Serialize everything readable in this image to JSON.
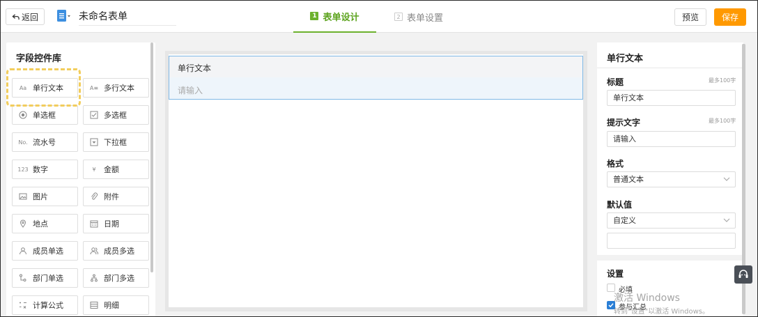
{
  "header": {
    "back_label": "返回",
    "form_name": "未命名表单",
    "steps": [
      {
        "num": "1",
        "label": "表单设计"
      },
      {
        "num": "2",
        "label": "表单设置"
      }
    ],
    "preview_label": "预览",
    "save_label": "保存",
    "accent_color": "#6cb12d",
    "save_color": "#ff9900"
  },
  "library": {
    "title": "字段控件库",
    "widgets": [
      {
        "label": "单行文本",
        "icon": "single-line-text-icon",
        "glyph": "Aa"
      },
      {
        "label": "多行文本",
        "icon": "multi-line-text-icon",
        "glyph": "A≡"
      },
      {
        "label": "单选框",
        "icon": "radio-icon",
        "glyph": ""
      },
      {
        "label": "多选框",
        "icon": "checkbox-icon",
        "glyph": ""
      },
      {
        "label": "流水号",
        "icon": "serial-number-icon",
        "glyph": "No."
      },
      {
        "label": "下拉框",
        "icon": "dropdown-icon",
        "glyph": ""
      },
      {
        "label": "数字",
        "icon": "number-icon",
        "glyph": "123"
      },
      {
        "label": "金额",
        "icon": "currency-icon",
        "glyph": "¥"
      },
      {
        "label": "图片",
        "icon": "image-icon",
        "glyph": ""
      },
      {
        "label": "附件",
        "icon": "paperclip-icon",
        "glyph": ""
      },
      {
        "label": "地点",
        "icon": "location-icon",
        "glyph": ""
      },
      {
        "label": "日期",
        "icon": "calendar-icon",
        "glyph": ""
      },
      {
        "label": "成员单选",
        "icon": "user-icon",
        "glyph": ""
      },
      {
        "label": "成员多选",
        "icon": "users-icon",
        "glyph": ""
      },
      {
        "label": "部门单选",
        "icon": "department-icon",
        "glyph": ""
      },
      {
        "label": "部门多选",
        "icon": "org-tree-icon",
        "glyph": ""
      },
      {
        "label": "计算公式",
        "icon": "formula-icon",
        "glyph": ""
      },
      {
        "label": "明细",
        "icon": "detail-list-icon",
        "glyph": ""
      }
    ]
  },
  "canvas": {
    "field_label": "单行文本",
    "field_placeholder": "请输入"
  },
  "properties": {
    "title": "单行文本",
    "title_label": "标题",
    "title_hint": "最多100字",
    "title_value": "单行文本",
    "prompt_label": "提示文字",
    "prompt_hint": "最多100字",
    "prompt_value": "请输入",
    "format_label": "格式",
    "format_value": "普通文本",
    "default_label": "默认值",
    "default_value": "自定义",
    "settings_label": "设置",
    "required_label": "必填",
    "required_checked": false,
    "summary_label": "参与汇总",
    "summary_checked": true
  },
  "watermark": {
    "line1": "激活 Windows",
    "line2": "转到\"设置\"以激活 Windows。"
  }
}
